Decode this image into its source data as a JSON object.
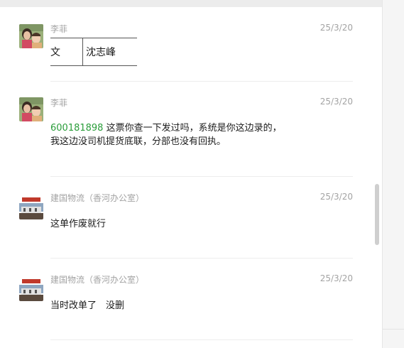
{
  "messages": [
    {
      "sender": "李菲",
      "time": "25/3/20",
      "table": [
        "文",
        "沈志峰"
      ]
    },
    {
      "sender": "李菲",
      "time": "25/3/20",
      "link": "600181898",
      "line1": " 这票你查一下发过吗，系统是你这边录的，",
      "line2": "我这边没司机提货底联，分部也没有回执。"
    },
    {
      "sender": "建国物流（香河办公室）",
      "time": "25/3/20",
      "text": "这单作废就行"
    },
    {
      "sender": "建国物流（香河办公室）",
      "time": "25/3/20",
      "text": "当时改单了　没删"
    }
  ]
}
